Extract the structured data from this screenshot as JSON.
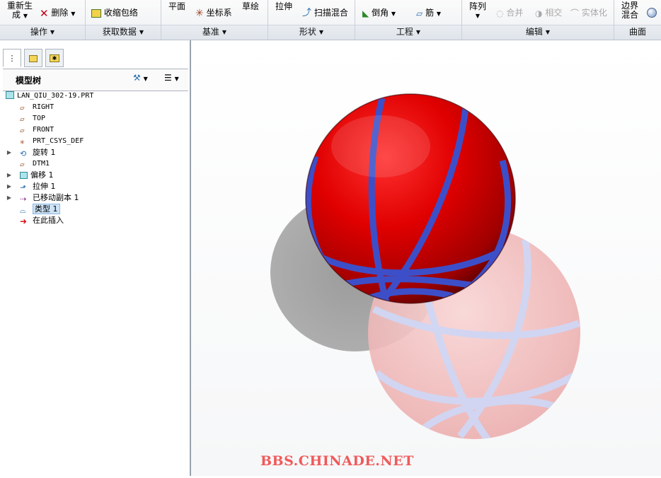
{
  "ribbon": {
    "groups": [
      {
        "title": "操作"
      },
      {
        "title": "获取数据"
      },
      {
        "title": "基准"
      },
      {
        "title": "形状"
      },
      {
        "title": "工程"
      },
      {
        "title": "编辑"
      },
      {
        "title": "曲面"
      }
    ],
    "ops": {
      "regen_line1": "重新生",
      "regen_line2": "成",
      "delete": "删除"
    },
    "data": {
      "shrinkwrap": "收缩包络"
    },
    "datum": {
      "plane": "平面",
      "csys": "坐标系",
      "sketch": "草绘"
    },
    "shape": {
      "extrude": "拉伸",
      "sweep_blend": "扫描混合"
    },
    "eng": {
      "round": "倒角",
      "rib": "筋"
    },
    "edit": {
      "pattern": "阵列",
      "merge": "合并",
      "intersect": "相交",
      "solidify": "实体化"
    },
    "surface": {
      "boundary_line1": "边界",
      "boundary_line2": "混合"
    }
  },
  "left_panel": {
    "tabs": [
      {
        "icon": "model-tree-icon"
      },
      {
        "icon": "layers-icon"
      },
      {
        "icon": "favorites-folder-icon"
      }
    ],
    "title": "模型树",
    "tree": [
      {
        "label": "LAN_QIU_302-19.PRT",
        "icon": "part-icon",
        "expandable": false
      },
      {
        "label": "RIGHT",
        "icon": "datum-plane-icon",
        "expandable": false
      },
      {
        "label": "TOP",
        "icon": "datum-plane-icon",
        "expandable": false
      },
      {
        "label": "FRONT",
        "icon": "datum-plane-icon",
        "expandable": false
      },
      {
        "label": "PRT_CSYS_DEF",
        "icon": "coordinate-system-icon",
        "expandable": false
      },
      {
        "label": "旋转 1",
        "icon": "revolve-icon",
        "expandable": true
      },
      {
        "label": "DTM1",
        "icon": "datum-plane-icon",
        "expandable": false
      },
      {
        "label": "偏移 1",
        "icon": "offset-icon",
        "expandable": true
      },
      {
        "label": "拉伸 1",
        "icon": "extrude-icon",
        "expandable": true
      },
      {
        "label": "已移动副本 1",
        "icon": "moved-copy-icon",
        "expandable": true
      },
      {
        "label": "类型 1",
        "icon": "surface-icon",
        "expandable": false,
        "selected": true
      },
      {
        "label": "在此插入",
        "icon": "insert-here-arrow-icon",
        "expandable": false
      }
    ]
  },
  "graphics": {
    "watermark": "BBS.CHINADE.NET",
    "colors": {
      "ball": "#e00000",
      "stripe": "#4a5fd0",
      "ghost": "#f4c4c4"
    }
  }
}
